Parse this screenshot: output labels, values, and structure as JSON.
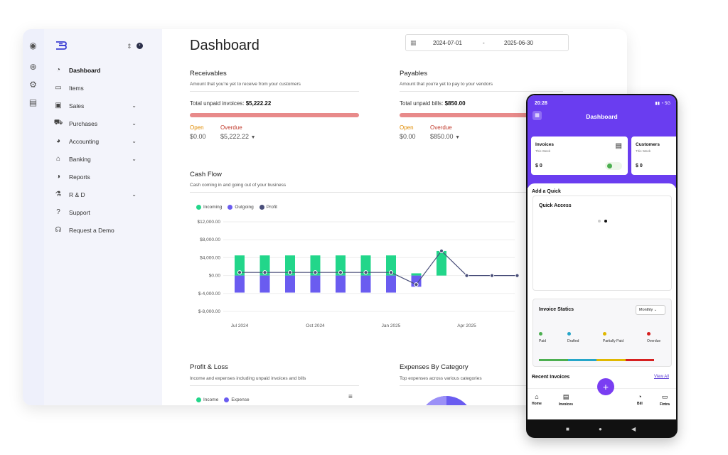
{
  "desktop": {
    "sidebar": {
      "items": [
        {
          "label": "Dashboard",
          "icon": "gauge-icon",
          "glyph": "◔",
          "chevron": false,
          "active": true
        },
        {
          "label": "Items",
          "icon": "box-icon",
          "glyph": "▭",
          "chevron": false
        },
        {
          "label": "Sales",
          "icon": "cash-icon",
          "glyph": "▣",
          "chevron": true
        },
        {
          "label": "Purchases",
          "icon": "cart-icon",
          "glyph": "⛟",
          "chevron": true
        },
        {
          "label": "Accounting",
          "icon": "pie-icon",
          "glyph": "◕",
          "chevron": true
        },
        {
          "label": "Banking",
          "icon": "bank-icon",
          "glyph": "⌂",
          "chevron": true
        },
        {
          "label": "Reports",
          "icon": "report-icon",
          "glyph": "◑",
          "chevron": false
        },
        {
          "label": "R & D",
          "icon": "flask-icon",
          "glyph": "⚗",
          "chevron": true
        },
        {
          "label": "Support",
          "icon": "help-icon",
          "glyph": "?",
          "chevron": false
        },
        {
          "label": "Request a Demo",
          "icon": "headset-icon",
          "glyph": "☊",
          "chevron": false
        }
      ]
    },
    "header": {
      "title": "Dashboard",
      "date_start": "2024-07-01",
      "date_sep": "-",
      "date_end": "2025-06-30"
    },
    "receivables": {
      "title": "Receivables",
      "subtitle": "Amount that you're yet to receive from your customers",
      "total_label": "Total unpaid invoices:",
      "total_value": "$5,222.22",
      "open_label": "Open",
      "overdue_label": "Overdue",
      "open_value": "$0.00",
      "overdue_value": "$5,222.22"
    },
    "payables": {
      "title": "Payables",
      "subtitle": "Amount that you're yet to pay to your vendors",
      "total_label": "Total unpaid bills:",
      "total_value": "$850.00",
      "open_label": "Open",
      "overdue_label": "Overdue",
      "open_value": "$0.00",
      "overdue_value": "$850.00"
    },
    "cashflow": {
      "title": "Cash Flow",
      "subtitle": "Cash coming in and going out of your business",
      "legend": [
        {
          "name": "Incoming",
          "color": "#22d68a"
        },
        {
          "name": "Outgoing",
          "color": "#6a5cf0"
        },
        {
          "name": "Profit",
          "color": "#4a4f7a"
        }
      ]
    },
    "profit_loss": {
      "title": "Profit & Loss",
      "subtitle": "Income and expenses including unpaid invoices and bills",
      "legend": [
        {
          "name": "Income",
          "color": "#22d68a"
        },
        {
          "name": "Expense",
          "color": "#6a5cf0"
        }
      ]
    },
    "expenses": {
      "title": "Expenses By Category",
      "subtitle": "Top expenses across various categories"
    }
  },
  "chart_data": {
    "type": "bar",
    "ytick_labels": [
      "$12,000.00",
      "$8,000.00",
      "$4,000.00",
      "$0.00",
      "$-4,000.00",
      "$-8,000.00"
    ],
    "ytick_values": [
      12000,
      8000,
      4000,
      0,
      -4000,
      -8000
    ],
    "ylim": [
      -8000,
      12000
    ],
    "xtick_labels": [
      {
        "label": "Jul 2024",
        "index": 0
      },
      {
        "label": "Oct 2024",
        "index": 3
      },
      {
        "label": "Jan 2025",
        "index": 6
      },
      {
        "label": "Apr 2025",
        "index": 9
      }
    ],
    "categories": [
      "Jul 2024",
      "Aug 2024",
      "Sep 2024",
      "Oct 2024",
      "Nov 2024",
      "Dec 2024",
      "Jan 2025",
      "Feb 2025",
      "Mar 2025",
      "Apr 2025",
      "May 2025",
      "Jun 2025"
    ],
    "series": [
      {
        "name": "Incoming",
        "values": [
          4500,
          4500,
          4500,
          4500,
          4500,
          4500,
          4500,
          500,
          5500,
          0,
          0,
          0
        ]
      },
      {
        "name": "Outgoing",
        "values": [
          -3800,
          -3800,
          -3800,
          -3800,
          -3800,
          -3800,
          -3800,
          -2500,
          0,
          0,
          0,
          0
        ]
      },
      {
        "name": "Profit",
        "values": [
          700,
          700,
          700,
          700,
          700,
          700,
          700,
          -2000,
          5500,
          0,
          0,
          0
        ]
      }
    ]
  },
  "phone": {
    "status_time": "20:28",
    "status_right": "▮▮ ◔ 5G",
    "title": "Dashboard",
    "cards": [
      {
        "title": "Invoices",
        "sub": "This Week",
        "value": "$ 0"
      },
      {
        "title": "Customers",
        "sub": "This Week",
        "value": "$ 0"
      }
    ],
    "add_quick": "Add a Quick",
    "quick_access": "Quick Access",
    "invoice_statics": "Invoice Statics",
    "period": "Monthly",
    "statuses": [
      {
        "label": "Paid",
        "color": "#4caf50"
      },
      {
        "label": "Drafted",
        "color": "#26a6c9"
      },
      {
        "label": "Partially Paid",
        "color": "#e0b800"
      },
      {
        "label": "Overdue",
        "color": "#d62020"
      }
    ],
    "recent_invoices": "Recent Invoices",
    "view_all": "View All",
    "nav": [
      {
        "label": "Home",
        "icon": "home-icon",
        "glyph": "⌂"
      },
      {
        "label": "Invoices",
        "icon": "file-icon",
        "glyph": "▤"
      },
      {
        "label": "Bill",
        "icon": "chart-icon",
        "glyph": "◔"
      },
      {
        "label": "Fintra",
        "icon": "chat-icon",
        "glyph": "▭"
      }
    ],
    "fab": "+"
  }
}
